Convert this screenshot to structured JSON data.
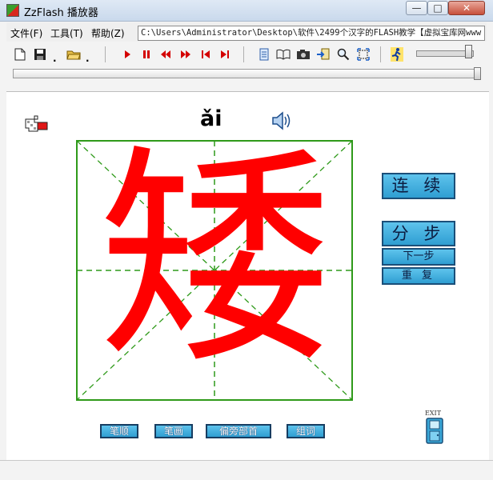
{
  "window": {
    "title": "ZzFlash 播放器",
    "min_glyph": "—",
    "max_glyph": "□",
    "close_glyph": "✕"
  },
  "menu": {
    "file": "文件(F)",
    "tools": "工具(T)",
    "help": "帮助(Z)"
  },
  "path": "C:\\Users\\Administrator\\Desktop\\软件\\2499个汉字的FLASH教学【虚拟宝库网www",
  "toolbar": {
    "new": "🗋",
    "save": "💾",
    "open": "📂",
    "dot": "."
  },
  "lesson": {
    "pinyin": "ǎi",
    "character": "矮",
    "stroke_color": "#ff0000",
    "grid_color": "#2f9a1a"
  },
  "controls": {
    "continuous": "连 续",
    "step": "分 步",
    "next_step": "下一步",
    "repeat": "重 复"
  },
  "bottom": {
    "stroke_order": "笔顺",
    "strokes": "笔画",
    "radical": "偏旁部首",
    "words": "组词",
    "exit": "EXIT"
  },
  "colors": {
    "button_blue": "#3aa8d9",
    "button_border": "#1b4f79"
  }
}
